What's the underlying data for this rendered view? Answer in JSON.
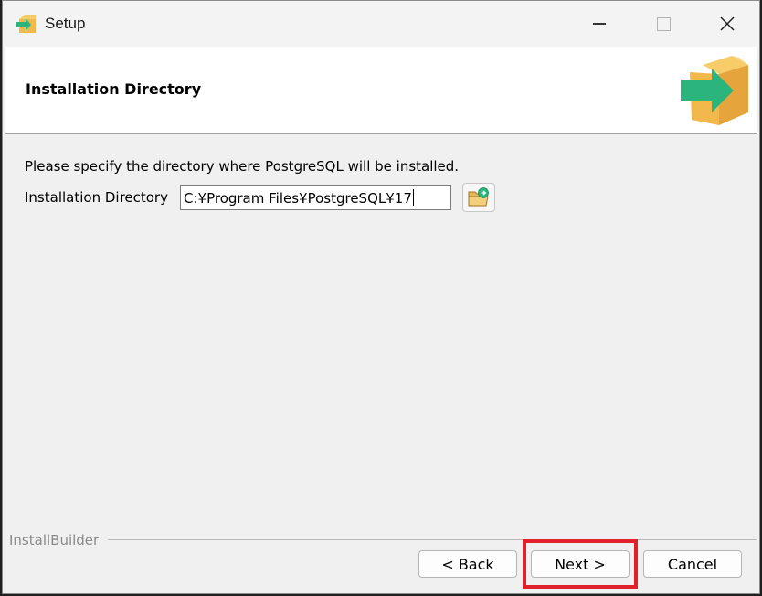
{
  "window": {
    "title": "Setup",
    "controls": {
      "minimize_icon": "minimize-icon",
      "maximize_icon": "maximize-icon",
      "close_icon": "close-icon"
    }
  },
  "header": {
    "title": "Installation Directory",
    "icon": "package-arrow-icon"
  },
  "content": {
    "description": "Please specify the directory where PostgreSQL will be installed.",
    "directory_label": "Installation Directory",
    "directory_value": "C:¥Program Files¥PostgreSQL¥17",
    "browse_icon": "folder-browse-icon"
  },
  "footer": {
    "brand": "InstallBuilder",
    "back_label": "< Back",
    "next_label": "Next >",
    "cancel_label": "Cancel"
  },
  "colors": {
    "highlight": "#e0202a",
    "background": "#f0f0f0",
    "header_bg": "#ffffff",
    "box_orange": "#f2b84b",
    "arrow_green": "#2bb57c"
  }
}
